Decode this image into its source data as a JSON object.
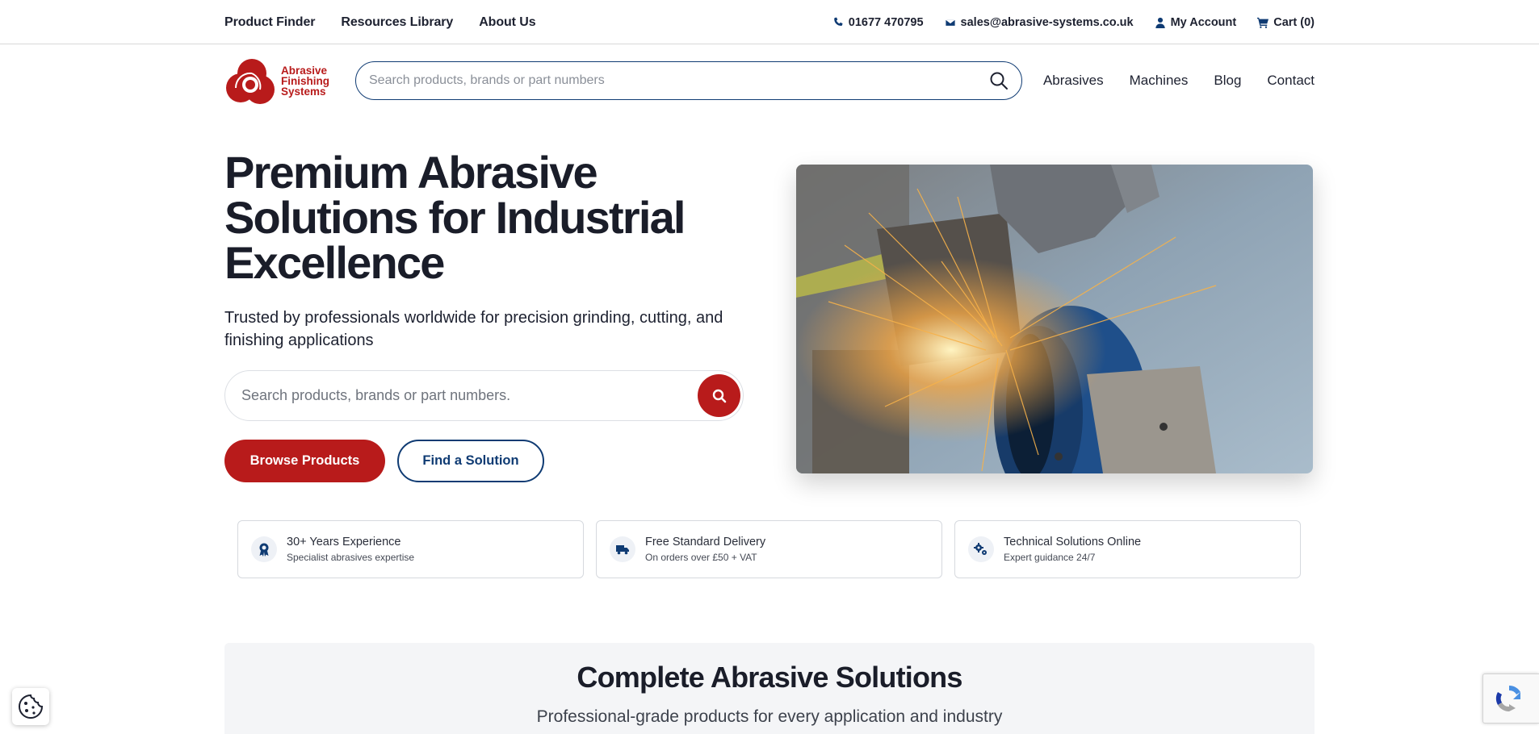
{
  "topbar": {
    "nav": [
      {
        "label": "Product Finder"
      },
      {
        "label": "Resources Library"
      },
      {
        "label": "About Us"
      }
    ],
    "phone": "01677 470795",
    "email": "sales@abrasive-systems.co.uk",
    "account": "My Account",
    "cart": "Cart (0)"
  },
  "header": {
    "logo": {
      "line1": "Abrasive",
      "line2": "Finishing",
      "line3": "Systems"
    },
    "search_placeholder": "Search products, brands or part numbers",
    "nav": [
      {
        "label": "Abrasives"
      },
      {
        "label": "Machines"
      },
      {
        "label": "Blog"
      },
      {
        "label": "Contact"
      }
    ]
  },
  "hero": {
    "title": "Premium Abrasive Solutions for Industrial Excellence",
    "subtitle": "Trusted by professionals worldwide for precision grinding, cutting, and finishing applications",
    "search_placeholder": "Search products, brands or part numbers.",
    "primary_button": "Browse Products",
    "secondary_button": "Find a Solution"
  },
  "features": [
    {
      "title": "30+ Years Experience",
      "subtitle": "Specialist abrasives expertise",
      "icon": "award-icon"
    },
    {
      "title": "Free Standard Delivery",
      "subtitle": "On orders over £50 + VAT",
      "icon": "truck-icon"
    },
    {
      "title": "Technical Solutions Online",
      "subtitle": "Expert guidance 24/7",
      "icon": "cogs-icon"
    }
  ],
  "solutions": {
    "title": "Complete Abrasive Solutions",
    "subtitle": "Professional-grade products for every application and industry"
  },
  "colors": {
    "brand_red": "#b81b1b",
    "brand_navy": "#0f3b73",
    "text_dark": "#1a1d29"
  }
}
